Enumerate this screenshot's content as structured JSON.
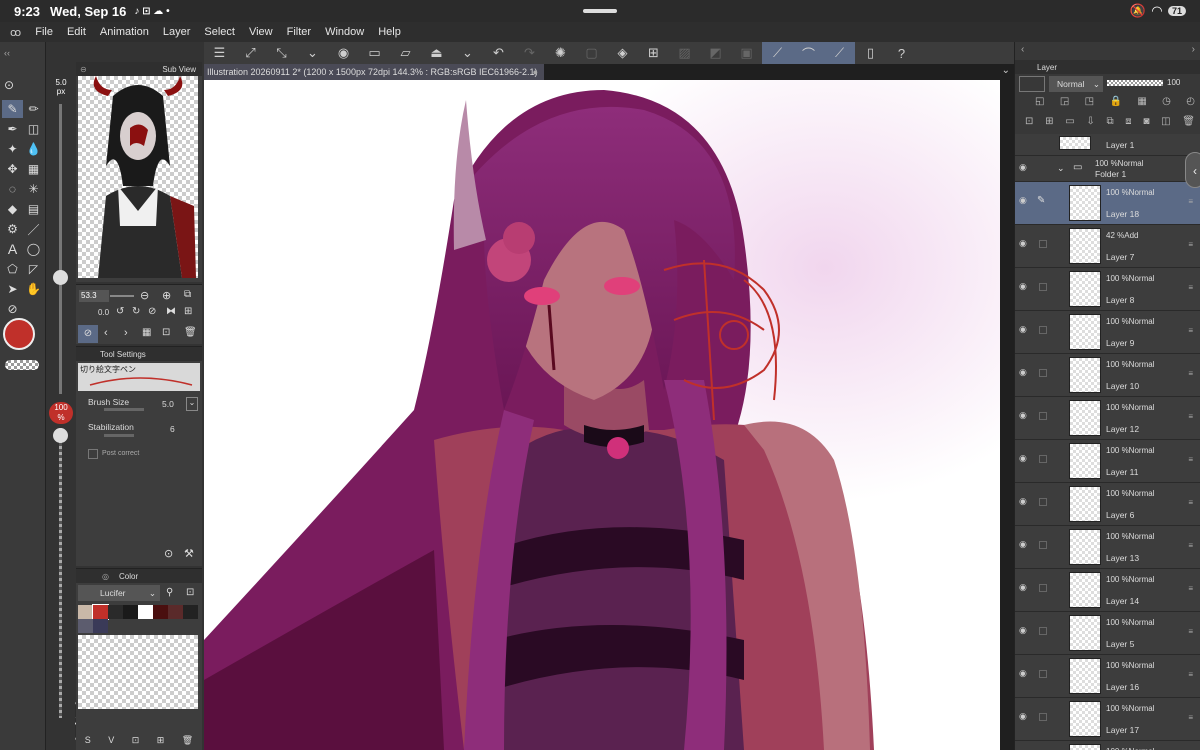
{
  "status": {
    "time": "9:23",
    "date": "Wed, Sep 16",
    "battery": "71"
  },
  "menu": [
    "File",
    "Edit",
    "Animation",
    "Layer",
    "Select",
    "View",
    "Filter",
    "Window",
    "Help"
  ],
  "document": {
    "tab": "Illustration 20260911 2* (1200 x 1500px 72dpi 144.3% : RGB:sRGB IEC61966-2.1)"
  },
  "tools": {
    "brush_size_px": "5.0",
    "brush_unit": "px",
    "opacity": "100",
    "opacity_unit": "%"
  },
  "subview": {
    "label": "Sub View",
    "zoom": "53.3",
    "rotate": "0.0"
  },
  "tool_settings": {
    "title": "Tool Settings",
    "brush_name": "切り絵文字ペン",
    "brush_size_label": "Brush Size",
    "brush_size": "5.0",
    "stabilization_label": "Stabilization",
    "stabilization": "6",
    "post_correct": "Post correct"
  },
  "color_panel": {
    "tab": "Color",
    "set_name": "Lucifer",
    "swatches": [
      "#c9b8a8",
      "#c0302a",
      "#2a2a2a",
      "#1a1a1a",
      "#ffffff",
      "#4a0f0f",
      "#5a2a2a",
      "#222222",
      "#5c5c6e",
      "#3a3a58"
    ]
  },
  "layer_panel": {
    "title": "Layer",
    "blend": "Normal",
    "opacity": "100",
    "layers": [
      {
        "name": "Layer 1",
        "mode": "",
        "indent": false
      },
      {
        "name": "Folder 1",
        "mode": "100 %Normal",
        "folder": true
      },
      {
        "name": "Layer 18",
        "mode": "100 %Normal",
        "selected": true
      },
      {
        "name": "Layer 7",
        "mode": "42 %Add"
      },
      {
        "name": "Layer 8",
        "mode": "100 %Normal"
      },
      {
        "name": "Layer 9",
        "mode": "100 %Normal"
      },
      {
        "name": "Layer 10",
        "mode": "100 %Normal"
      },
      {
        "name": "Layer 12",
        "mode": "100 %Normal"
      },
      {
        "name": "Layer 11",
        "mode": "100 %Normal"
      },
      {
        "name": "Layer 6",
        "mode": "100 %Normal"
      },
      {
        "name": "Layer 13",
        "mode": "100 %Normal"
      },
      {
        "name": "Layer 14",
        "mode": "100 %Normal"
      },
      {
        "name": "Layer 5",
        "mode": "100 %Normal"
      },
      {
        "name": "Layer 16",
        "mode": "100 %Normal"
      },
      {
        "name": "Layer 17",
        "mode": "100 %Normal"
      },
      {
        "name": "",
        "mode": "100 %Normal"
      }
    ]
  },
  "colors": {
    "accent": "#5b6a86",
    "main_color": "#c0302a"
  }
}
